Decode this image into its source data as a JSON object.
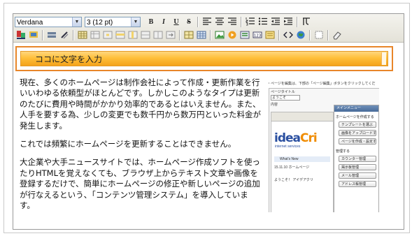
{
  "toolbar": {
    "font_family": "Verdana",
    "font_size": "3 (12 pt)",
    "buttons_row1": [
      "B",
      "I",
      "U",
      "S"
    ]
  },
  "title_box": {
    "text": "ココに文字を入力"
  },
  "body": {
    "paragraphs": [
      "現在、多くのホームページは制作会社によって作成・更新作業を行いいわゆる依頼型がほとんどです。しかしこのようなタイプは更新のたびに費用や時間がかかり効率的であるとはいえません。また、人手を要する為、少しの変更でも数千円から数万円といった料金が発生します。",
      "これでは頻繁にホームページを更新することはできません。",
      "大企業や大手ニュースサイトでは、ホームページ作成ソフトを使ったりHTMLを覚えなくても、ブラウザ上からテキスト文章や画像を登録するだけで、簡単にホームページの修正や新しいページの追加が行なえるという、「コンテンツ管理システム」を導入しています。"
    ]
  },
  "screenshot": {
    "caption": "・ページを編集は、下部の「ページ編集」ボタンをクリックしてくだ",
    "field_label": "ページタイトル",
    "field_value": "ようこそ",
    "content_label": "内容",
    "logo_main": "idea",
    "logo_accent": "Cri",
    "logo_sub": "internet services",
    "whats_new": "What's New",
    "news_line": "15.11.10 ホームページ",
    "welcome_line": "ようこそ！ アイデアクリ",
    "menu_title": "メインメニュー",
    "menu_items": [
      "ホームページを作成する",
      "テンプレートを選ぶ",
      "画像をアップロードする",
      "ページを作成・設定する",
      "管理する",
      "カウンター管理",
      "掲示板管理",
      "メール管理",
      "アドレス帳管理"
    ]
  }
}
